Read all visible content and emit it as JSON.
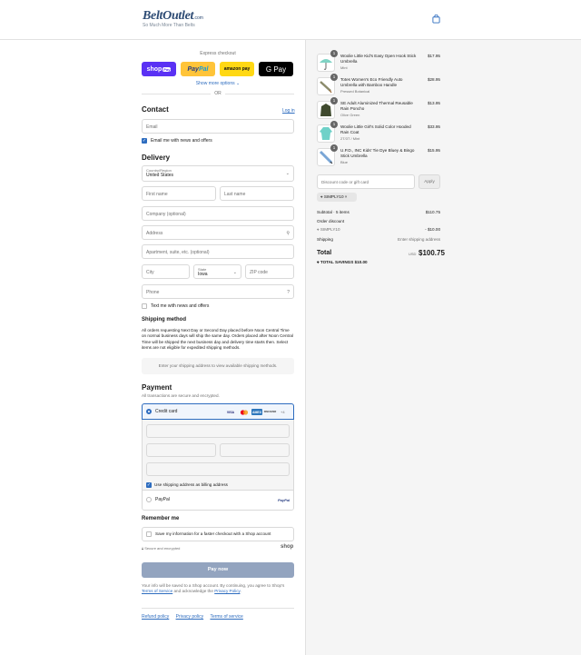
{
  "header": {
    "logo_main": "BeltOutlet",
    "logo_suffix": ".com",
    "logo_tagline": "So Much More Than Belts"
  },
  "express": {
    "title": "Express checkout",
    "shop_label": "shop",
    "shop_pay": "Pay",
    "paypal_a": "Pay",
    "paypal_b": "Pal",
    "amazon_label": "amazon pay",
    "gpay_label": "G Pay",
    "show_more": "Show more options",
    "or": "OR"
  },
  "contact": {
    "heading": "Contact",
    "login": "Log in",
    "email_placeholder": "Email",
    "email_news": "Email me with news and offers"
  },
  "delivery": {
    "heading": "Delivery",
    "country_label": "Country/Region",
    "country_value": "United States",
    "first_name": "First name",
    "last_name": "Last name",
    "company": "Company (optional)",
    "address": "Address",
    "apartment": "Apartment, suite, etc. (optional)",
    "city": "City",
    "state_label": "State",
    "state_value": "Iowa",
    "zip": "ZIP code",
    "phone": "Phone",
    "text_news": "Text me with news and offers"
  },
  "shipping": {
    "heading": "Shipping method",
    "note": "All orders requesting Next Day or Second Day placed before Noon Central Time on normal business days will ship the same day. Orders placed after Noon Central Time will be shipped the next business day and delivery time starts then. Select items are not eligible for expedited shipping methods.",
    "placeholder": "Enter your shipping address to view available shipping methods."
  },
  "payment": {
    "heading": "Payment",
    "subheading": "All transactions are secure and encrypted.",
    "credit_card": "Credit card",
    "brands": [
      "VISA",
      "MC",
      "AMEX",
      "DISCOVER"
    ],
    "more_brands": "+4",
    "billing_same": "Use shipping address as billing address",
    "paypal": "PayPal",
    "paypal_logo": "PayPal"
  },
  "remember": {
    "heading": "Remember me",
    "save_info": "Save my information for a faster checkout with a Shop account",
    "secure": "Secure and encrypted",
    "shop_logo": "shop"
  },
  "pay_now": "Pay now",
  "legal": {
    "text_a": "Your info will be saved to a Shop account. By continuing, you agree to Shop's",
    "terms": "Terms of Service",
    "text_b": "and acknowledge the",
    "privacy": "Privacy Policy",
    "text_c": "."
  },
  "footer": {
    "refund": "Refund policy",
    "privacy": "Privacy policy",
    "terms": "Terms of service"
  },
  "cart": {
    "items": [
      {
        "qty": "1",
        "name": "Woolie Little Kid's Easy Open Hook Stick Umbrella",
        "variant": "Mint",
        "price": "$17.95"
      },
      {
        "qty": "1",
        "name": "Totes Women's Eco Friendly Auto Umbrella with Bamboo Handle",
        "variant": "Pressed Botanical",
        "price": "$28.95"
      },
      {
        "qty": "1",
        "name": "SE Adult Aluminized Thermal Reusable Rain Poncho",
        "variant": "Olive Green",
        "price": "$13.95"
      },
      {
        "qty": "1",
        "name": "Woolie Little Girl's Solid Color Hooded Rain Coat",
        "variant": "2T/3T / Mint",
        "price": "$33.95"
      },
      {
        "qty": "1",
        "name": "U.P.D., INC Kids' Tie Dye Bluey & Bingo Stick Umbrella",
        "variant": "Blue",
        "price": "$15.95"
      }
    ],
    "discount_placeholder": "Discount code or gift card",
    "apply": "Apply",
    "tag": "SIMPLY10",
    "subtotal_label": "Subtotal · 5 items",
    "subtotal": "$110.75",
    "order_discount": "Order discount",
    "code": "SIMPLY10",
    "discount": "- $10.00",
    "shipping_label": "Shipping",
    "shipping_value": "Enter shipping address",
    "total_label": "Total",
    "currency": "USD",
    "total": "$100.75",
    "savings": "TOTAL SAVINGS $10.00"
  }
}
